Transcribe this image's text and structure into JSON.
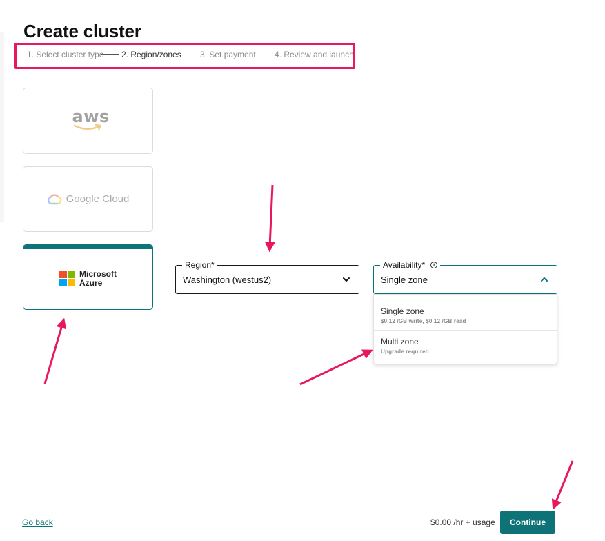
{
  "page": {
    "title": "Create cluster"
  },
  "stepper": {
    "steps": [
      {
        "label": "1. Select cluster type"
      },
      {
        "label": "2. Region/zones"
      },
      {
        "label": "3. Set payment"
      },
      {
        "label": "4. Review and launch"
      }
    ],
    "active_index": 1
  },
  "providers": [
    {
      "name": "aws",
      "logo_text": "aws",
      "selected": false
    },
    {
      "name": "google-cloud",
      "logo_text": "Google Cloud",
      "selected": false
    },
    {
      "name": "microsoft-azure",
      "logo_line1": "Microsoft",
      "logo_line2": "Azure",
      "selected": true
    }
  ],
  "region": {
    "label": "Region*",
    "value": "Washington (westus2)"
  },
  "availability": {
    "label": "Availability*",
    "value": "Single zone",
    "options": [
      {
        "title": "Single zone",
        "detail": "$0.12 /GB write, $0.12 /GB read"
      },
      {
        "title": "Multi zone",
        "detail": "Upgrade required"
      }
    ]
  },
  "footer": {
    "go_back": "Go back",
    "price": "$0.00 /hr + usage",
    "continue": "Continue"
  },
  "icons": {
    "region_chevron": "chevron-down-icon",
    "availability_chevron": "chevron-up-icon",
    "availability_info": "info-icon",
    "annotation_arrow": "arrow-icon"
  },
  "colors": {
    "accent": "#0d7377",
    "highlight": "#e8185f",
    "ms_red": "#f25022",
    "ms_green": "#7fba00",
    "ms_blue": "#00a4ef",
    "ms_yellow": "#ffb900"
  }
}
